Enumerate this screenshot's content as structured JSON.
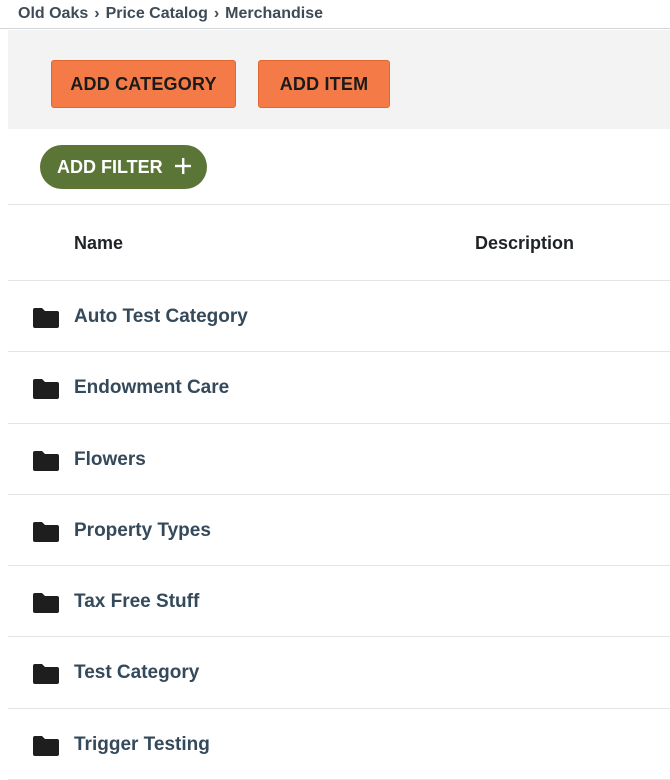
{
  "breadcrumb": {
    "items": [
      "Old Oaks",
      "Price Catalog",
      "Merchandise"
    ],
    "separator": "›"
  },
  "toolbar": {
    "add_category_label": "ADD CATEGORY",
    "add_item_label": "ADD ITEM"
  },
  "filter": {
    "add_filter_label": "ADD FILTER",
    "icon": "plus-icon"
  },
  "table": {
    "columns": [
      "Name",
      "Description"
    ],
    "rows": [
      {
        "name": "Auto Test Category",
        "description": "",
        "icon": "folder-icon"
      },
      {
        "name": "Endowment Care",
        "description": "",
        "icon": "folder-icon"
      },
      {
        "name": "Flowers",
        "description": "",
        "icon": "folder-icon"
      },
      {
        "name": "Property Types",
        "description": "",
        "icon": "folder-icon"
      },
      {
        "name": "Tax Free Stuff",
        "description": "",
        "icon": "folder-icon"
      },
      {
        "name": "Test Category",
        "description": "",
        "icon": "folder-icon"
      },
      {
        "name": "Trigger Testing",
        "description": "",
        "icon": "folder-icon"
      }
    ]
  },
  "colors": {
    "orange_button": "#f47a47",
    "filter_button": "#5b7537",
    "toolbar_bg": "#f3f3f3",
    "row_text": "#34495a"
  }
}
